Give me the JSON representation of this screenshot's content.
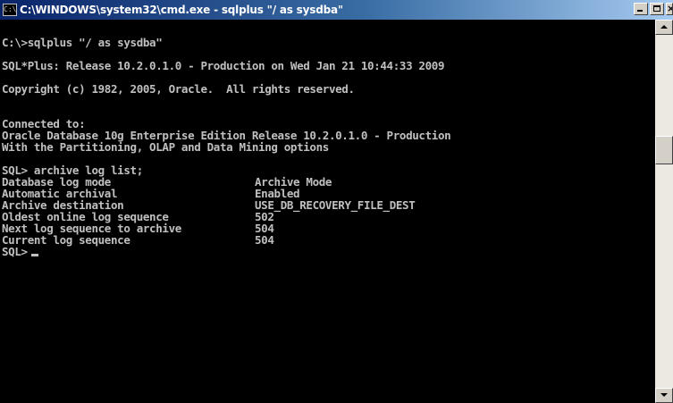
{
  "window": {
    "title": "C:\\WINDOWS\\system32\\cmd.exe - sqlplus \"/ as sysdba\"",
    "icon": "cmd-console-icon",
    "icon_glyph": "C:\\",
    "buttons": {
      "minimize": "minimize-icon",
      "maximize": "maximize-icon",
      "close": "close-icon",
      "close_glyph": "×"
    }
  },
  "console": {
    "command": "C:\\>sqlplus \"/ as sysdba\"",
    "banner": "SQL*Plus: Release 10.2.0.1.0 - Production on Wed Jan 21 10:44:33 2009",
    "copyright": "Copyright (c) 1982, 2005, Oracle.  All rights reserved.",
    "connected": "Connected to:",
    "db_version": "Oracle Database 10g Enterprise Edition Release 10.2.0.1.0 - Production",
    "options": "With the Partitioning, OLAP and Data Mining options",
    "sql_command": "SQL> archive log list;",
    "archive_rows": [
      {
        "label": "Database log mode",
        "value": "Archive Mode"
      },
      {
        "label": "Automatic archival",
        "value": "Enabled"
      },
      {
        "label": "Archive destination",
        "value": "USE_DB_RECOVERY_FILE_DEST"
      },
      {
        "label": "Oldest online log sequence",
        "value": "502"
      },
      {
        "label": "Next log sequence to archive",
        "value": "504"
      },
      {
        "label": "Current log sequence",
        "value": "504"
      }
    ],
    "prompt": "SQL>"
  },
  "colors": {
    "console_bg": "#000000",
    "console_fg": "#c0c0c0",
    "titlebar_start": "#0a246a",
    "titlebar_end": "#a6caf0"
  }
}
